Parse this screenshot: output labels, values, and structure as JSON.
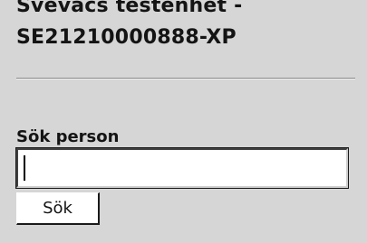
{
  "unit": {
    "title_line1": "Svevacs testenhet -",
    "title_line2": "SE21210000888-XP"
  },
  "search": {
    "label": "Sök person",
    "input_value": "",
    "button_label": "Sök"
  },
  "colors": {
    "background": "#d6d6d6",
    "text": "#141414"
  }
}
